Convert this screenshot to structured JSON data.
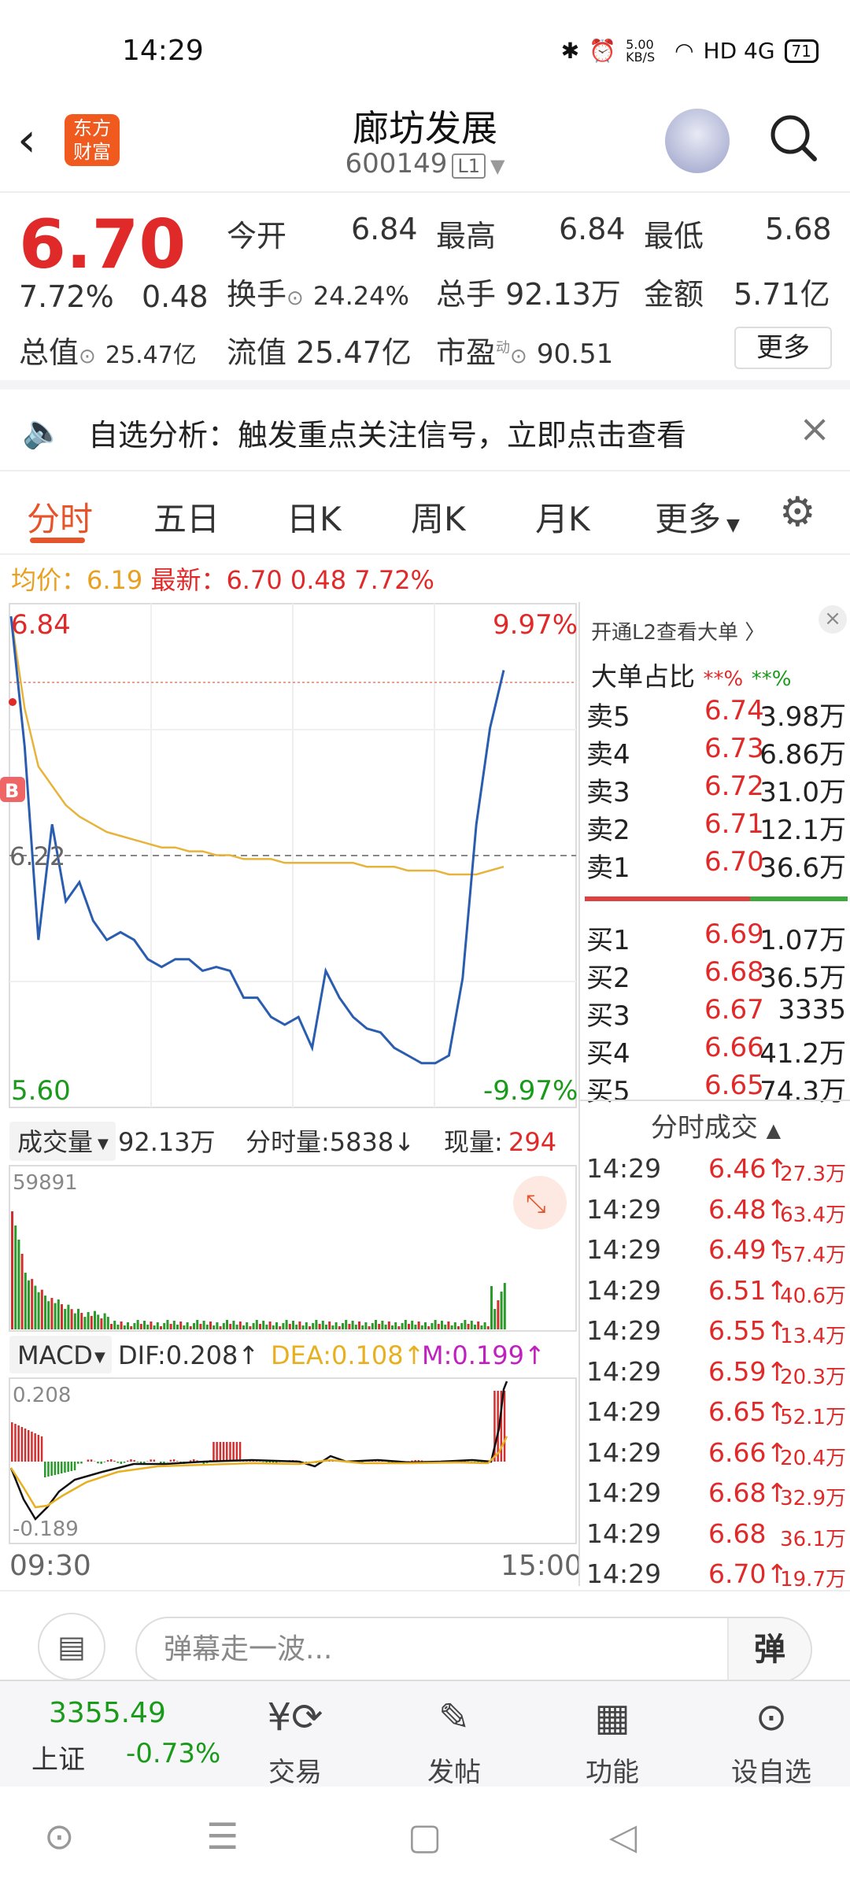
{
  "status_bar": {
    "time": "14:29",
    "net_speed": "5.00 KB/S",
    "signal": "HD 4G",
    "battery": "71"
  },
  "header": {
    "logo_text": "东方\n财富",
    "stock_name": "廊坊发展",
    "stock_code": "600149",
    "level_badge": "L1"
  },
  "quote": {
    "price": "6.70",
    "change_pct": "7.72%",
    "change": "0.48",
    "open_label": "今开",
    "open": "6.84",
    "high_label": "最高",
    "high": "6.84",
    "low_label": "最低",
    "low": "5.68",
    "turnover_label": "换手",
    "turnover": "24.24%",
    "volume_label": "总手",
    "volume": "92.13万",
    "amount_label": "金额",
    "amount": "5.71亿",
    "mktcap_label": "总值",
    "mktcap": "25.47亿",
    "float_label": "流值",
    "float_cap": "25.47亿",
    "pe_label": "市盈",
    "pe_sup": "动",
    "pe": "90.51",
    "more_label": "更多"
  },
  "notice": {
    "text": "自选分析：触发重点关注信号，立即点击查看"
  },
  "tabs": [
    {
      "label": "分时"
    },
    {
      "label": "五日"
    },
    {
      "label": "日K"
    },
    {
      "label": "周K"
    },
    {
      "label": "月K"
    },
    {
      "label": "更多"
    }
  ],
  "avg_line": {
    "avg_label": "均价：6.19",
    "latest_label": "最新：6.70",
    "change": "0.48",
    "pct": "7.72%"
  },
  "chart_data": {
    "type": "line",
    "title": "",
    "y_max": "6.84",
    "y_max_pct": "9.97%",
    "y_min": "5.60",
    "y_min_pct": "-9.97%",
    "y_mid": "6.22",
    "xlabels": [
      "09:30",
      "15:00"
    ],
    "buy_marker": "B",
    "series": [
      {
        "name": "price",
        "color": "#2a5db0",
        "values": [
          6.84,
          6.5,
          6.0,
          6.3,
          6.1,
          6.15,
          6.05,
          6.0,
          6.02,
          6.0,
          5.95,
          5.93,
          5.95,
          5.95,
          5.92,
          5.93,
          5.92,
          5.85,
          5.85,
          5.8,
          5.78,
          5.8,
          5.72,
          5.92,
          5.85,
          5.8,
          5.77,
          5.76,
          5.72,
          5.7,
          5.68,
          5.68,
          5.7,
          5.9,
          6.3,
          6.55,
          6.7
        ]
      },
      {
        "name": "avg",
        "color": "#e8b33a",
        "values": [
          6.84,
          6.6,
          6.45,
          6.4,
          6.35,
          6.32,
          6.3,
          6.28,
          6.27,
          6.26,
          6.25,
          6.24,
          6.24,
          6.23,
          6.23,
          6.22,
          6.22,
          6.21,
          6.21,
          6.21,
          6.2,
          6.2,
          6.2,
          6.2,
          6.2,
          6.2,
          6.19,
          6.19,
          6.19,
          6.18,
          6.18,
          6.18,
          6.17,
          6.17,
          6.17,
          6.18,
          6.19
        ]
      }
    ],
    "ylim": [
      5.6,
      6.84
    ]
  },
  "volume": {
    "label": "成交量",
    "total": "92.13万",
    "tick_label": "分时量:5838↓",
    "now_label": "现量:",
    "now": "294",
    "max": "59891"
  },
  "macd": {
    "label": "MACD",
    "dif": "DIF:0.208↑",
    "dea": "DEA:0.108↑",
    "m": "M:0.199↑",
    "top": "0.208",
    "bottom": "-0.189"
  },
  "order_book": {
    "l2_label": "开通L2查看大单 〉",
    "big_label": "大单占比",
    "big_red": "**%",
    "big_green": "**%",
    "sells": [
      {
        "l": "卖5",
        "p": "6.74",
        "v": "3.98万"
      },
      {
        "l": "卖4",
        "p": "6.73",
        "v": "6.86万"
      },
      {
        "l": "卖3",
        "p": "6.72",
        "v": "31.0万"
      },
      {
        "l": "卖2",
        "p": "6.71",
        "v": "12.1万"
      },
      {
        "l": "卖1",
        "p": "6.70",
        "v": "36.6万"
      }
    ],
    "buys": [
      {
        "l": "买1",
        "p": "6.69",
        "v": "1.07万"
      },
      {
        "l": "买2",
        "p": "6.68",
        "v": "36.5万"
      },
      {
        "l": "买3",
        "p": "6.67",
        "v": "3335"
      },
      {
        "l": "买4",
        "p": "6.66",
        "v": "41.2万"
      },
      {
        "l": "买5",
        "p": "6.65",
        "v": "74.3万"
      }
    ]
  },
  "trades": {
    "title": "分时成交",
    "rows": [
      {
        "t": "14:29",
        "p": "6.46↑",
        "v": "27.3万"
      },
      {
        "t": "14:29",
        "p": "6.48↑",
        "v": "63.4万"
      },
      {
        "t": "14:29",
        "p": "6.49↑",
        "v": "57.4万"
      },
      {
        "t": "14:29",
        "p": "6.51↑",
        "v": "40.6万"
      },
      {
        "t": "14:29",
        "p": "6.55↑",
        "v": "13.4万"
      },
      {
        "t": "14:29",
        "p": "6.59↑",
        "v": "20.3万"
      },
      {
        "t": "14:29",
        "p": "6.65↑",
        "v": "52.1万"
      },
      {
        "t": "14:29",
        "p": "6.66↑",
        "v": "20.4万"
      },
      {
        "t": "14:29",
        "p": "6.68↑",
        "v": "32.9万"
      },
      {
        "t": "14:29",
        "p": "6.68",
        "v": "36.1万"
      },
      {
        "t": "14:29",
        "p": "6.70↑",
        "v": "19.7万"
      }
    ]
  },
  "input": {
    "placeholder": "弹幕走一波...",
    "send": "弹"
  },
  "bottom_nav": {
    "index_value": "3355.49",
    "index_name": "上证",
    "index_change": "-0.73%",
    "items": [
      {
        "label": "交易"
      },
      {
        "label": "发帖"
      },
      {
        "label": "功能"
      },
      {
        "label": "设自选"
      }
    ]
  }
}
